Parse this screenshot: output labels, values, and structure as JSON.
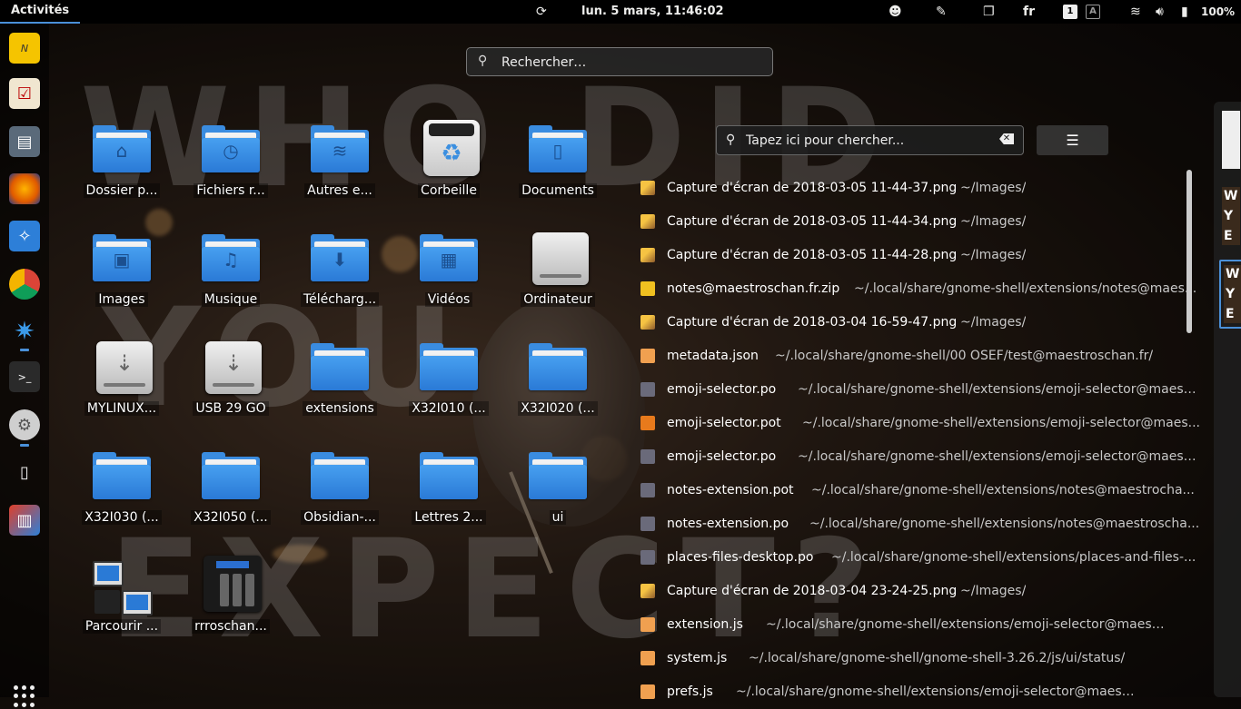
{
  "topbar": {
    "activities": "Activités",
    "clock": "lun.  5 mars, 11:46:02",
    "lang": "fr",
    "workspace_indicator": "1",
    "accessibility_box": "A",
    "battery": "100%"
  },
  "shell_search": {
    "placeholder": "Rechercher…"
  },
  "background_words": [
    "WHO DID",
    "YOU",
    "EXPECT?"
  ],
  "dock": {
    "items": [
      "notes-app",
      "todo-app",
      "files-app",
      "firefox",
      "safari-like",
      "chrome",
      "settings-gear",
      "terminal",
      "tweaks",
      "usb-stick",
      "monitor"
    ]
  },
  "desktop_icons": [
    {
      "label": "Dossier p...",
      "kind": "folder",
      "glyph": "home-icon"
    },
    {
      "label": "Fichiers r...",
      "kind": "folder",
      "glyph": "clock-icon"
    },
    {
      "label": "Autres e...",
      "kind": "folder",
      "glyph": "wifi-icon"
    },
    {
      "label": "Corbeille",
      "kind": "trash"
    },
    {
      "label": "Documents",
      "kind": "folder",
      "glyph": "document-icon"
    },
    {
      "label": "Images",
      "kind": "folder",
      "glyph": "image-icon"
    },
    {
      "label": "Musique",
      "kind": "folder",
      "glyph": "music-icon"
    },
    {
      "label": "Télécharg...",
      "kind": "folder",
      "glyph": "download-icon"
    },
    {
      "label": "Vidéos",
      "kind": "folder",
      "glyph": "film-icon"
    },
    {
      "label": "Ordinateur",
      "kind": "drive"
    },
    {
      "label": "MYLINUX...",
      "kind": "usb"
    },
    {
      "label": "USB 29 GO",
      "kind": "usb"
    },
    {
      "label": "extensions",
      "kind": "folder"
    },
    {
      "label": "X32I010 (...",
      "kind": "folder"
    },
    {
      "label": "X32I020 (...",
      "kind": "folder"
    },
    {
      "label": "X32I030 (...",
      "kind": "folder"
    },
    {
      "label": "X32I050 (...",
      "kind": "folder"
    },
    {
      "label": "Obsidian-...",
      "kind": "folder"
    },
    {
      "label": "Lettres 2...",
      "kind": "folder"
    },
    {
      "label": "ui",
      "kind": "folder"
    },
    {
      "label": "Parcourir ...",
      "kind": "network"
    },
    {
      "label": "rrroschan...",
      "kind": "nas"
    }
  ],
  "files_panel": {
    "search_placeholder": "Tapez ici pour chercher...",
    "files": [
      {
        "name": "Capture d'écran de 2018-03-05 11-44-37.png",
        "path": "~/Images/",
        "type": "img"
      },
      {
        "name": "Capture d'écran de 2018-03-05 11-44-34.png",
        "path": "~/Images/",
        "type": "img"
      },
      {
        "name": "Capture d'écran de 2018-03-05 11-44-28.png",
        "path": "~/Images/",
        "type": "img"
      },
      {
        "name": "notes@maestroschan.fr.zip",
        "path": "~/.local/share/gnome-shell/extensions/notes@maes...",
        "type": "zip"
      },
      {
        "name": "Capture d'écran de 2018-03-04 16-59-47.png",
        "path": "~/Images/",
        "type": "img"
      },
      {
        "name": "metadata.json",
        "path": "~/.local/share/gnome-shell/00 OSEF/test@maestroschan.fr/",
        "type": "code"
      },
      {
        "name": "emoji-selector.po",
        "path": "~/.local/share/gnome-shell/extensions/emoji-selector@maest...",
        "type": "po"
      },
      {
        "name": "emoji-selector.pot",
        "path": "~/.local/share/gnome-shell/extensions/emoji-selector@maes...",
        "type": "pot"
      },
      {
        "name": "emoji-selector.po",
        "path": "~/.local/share/gnome-shell/extensions/emoji-selector@maest...",
        "type": "po"
      },
      {
        "name": "notes-extension.pot",
        "path": "~/.local/share/gnome-shell/extensions/notes@maestrocha...",
        "type": "po"
      },
      {
        "name": "notes-extension.po",
        "path": "~/.local/share/gnome-shell/extensions/notes@maestroscha...",
        "type": "po"
      },
      {
        "name": "places-files-desktop.po",
        "path": "~/.local/share/gnome-shell/extensions/places-and-files-...",
        "type": "po"
      },
      {
        "name": "Capture d'écran de 2018-03-04 23-24-25.png",
        "path": "~/Images/",
        "type": "img"
      },
      {
        "name": "extension.js",
        "path": "~/.local/share/gnome-shell/extensions/emoji-selector@maestrosch...",
        "type": "code"
      },
      {
        "name": "system.js",
        "path": "~/.local/share/gnome-shell/gnome-shell-3.26.2/js/ui/status/",
        "type": "code"
      },
      {
        "name": "prefs.js",
        "path": "~/.local/share/gnome-shell/extensions/emoji-selector@maestroschan.fr/",
        "type": "code"
      }
    ]
  },
  "workspaces": {
    "thumb_text": [
      "W",
      "Y",
      "E"
    ]
  }
}
